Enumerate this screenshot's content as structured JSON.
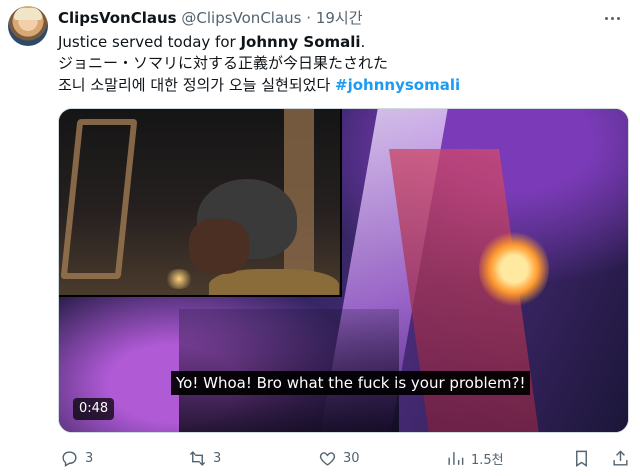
{
  "tweet": {
    "author_name": "ClipsVonClaus",
    "author_handle": "@ClipsVonClaus",
    "separator": "·",
    "time": "19시간",
    "line1_prefix": "Justice served today for ",
    "line1_bold": "Johnny Somali",
    "line1_suffix": ".",
    "line2": "ジョニー・ソマリに対する正義が今日果たされた",
    "line3_prefix": "조니 소말리에 대한 정의가 오늘 실현되었다 ",
    "line3_hashtag": "#johnnysomali"
  },
  "video": {
    "caption": "Yo! Whoa! Bro what the fuck is your problem?!",
    "duration": "0:48"
  },
  "actions": {
    "reply_count": "3",
    "retweet_count": "3",
    "like_count": "30",
    "view_count": "1.5천"
  },
  "icons": {
    "more": "more-dots-icon",
    "reply": "reply-icon",
    "retweet": "retweet-icon",
    "like": "heart-icon",
    "views": "views-icon",
    "bookmark": "bookmark-icon",
    "share": "share-icon"
  },
  "colors": {
    "text": "#0f1419",
    "muted": "#536471",
    "link": "#1d9bf0"
  }
}
